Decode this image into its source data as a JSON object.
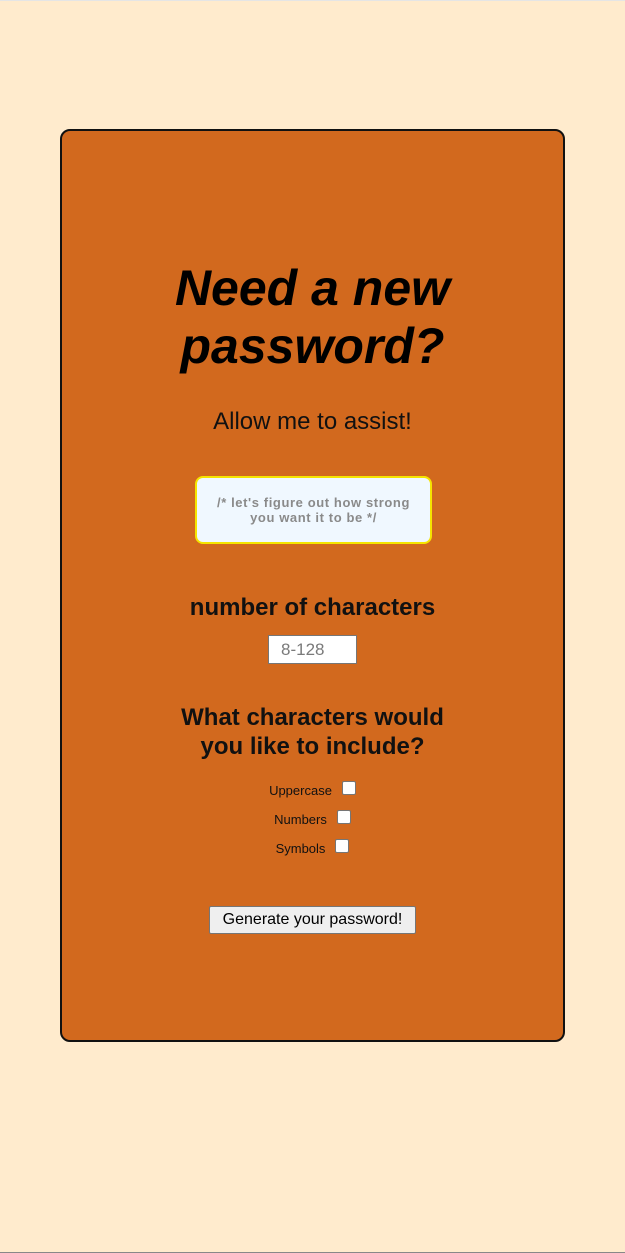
{
  "header": {
    "title_line1": "Need a new",
    "title_line2": "password?",
    "subtitle": "Allow me to assist!"
  },
  "hint": {
    "text": "/* let's figure out how strong you want it to be */"
  },
  "length": {
    "label": "number of characters",
    "placeholder": "8-128",
    "value": ""
  },
  "include": {
    "heading_line1": "What characters would",
    "heading_line2": "you like to include?",
    "options": [
      {
        "label": "Uppercase",
        "checked": false
      },
      {
        "label": "Numbers",
        "checked": false
      },
      {
        "label": "Symbols",
        "checked": false
      }
    ]
  },
  "actions": {
    "generate_label": "Generate your password!"
  },
  "colors": {
    "page_background": "#ffebcd",
    "card_background": "#d2691e",
    "hint_background": "#f0f8ff",
    "hint_border": "#f5e400"
  }
}
